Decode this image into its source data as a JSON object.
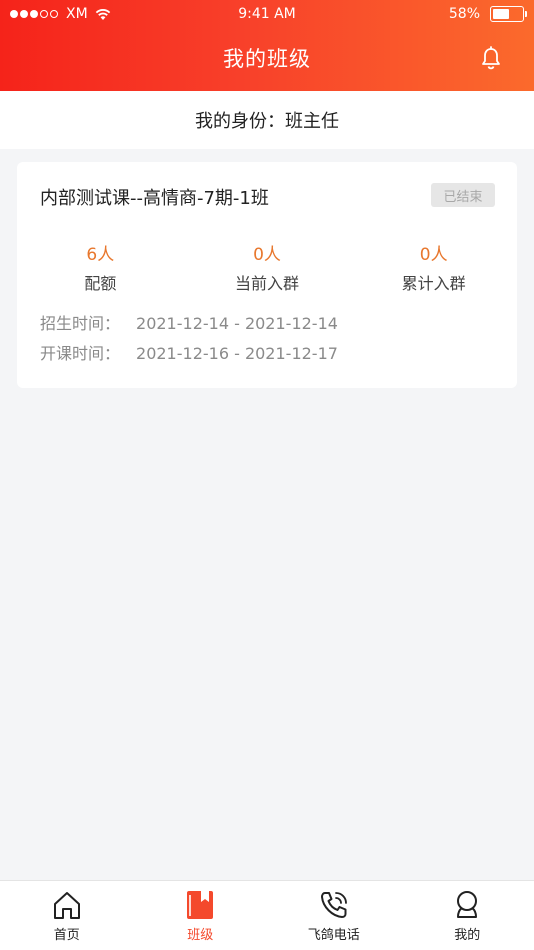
{
  "status_bar": {
    "carrier": "XM",
    "time": "9:41 AM",
    "battery": "58%",
    "battery_level": 0.58,
    "signal_filled": 3,
    "signal_total": 5
  },
  "nav": {
    "title": "我的班级",
    "bell_icon": "bell-icon"
  },
  "role": {
    "text": "我的身份：班主任"
  },
  "class_card": {
    "title": "内部测试课--高情商-7期-1班",
    "status": "已结束",
    "stats": [
      {
        "value": "6人",
        "label": "配额"
      },
      {
        "value": "0人",
        "label": "当前入群"
      },
      {
        "value": "0人",
        "label": "累计入群"
      }
    ],
    "enroll_label": "招生时间：",
    "enroll_range": "2021-12-14 - 2021-12-14",
    "class_label": "开课时间：",
    "class_range": "2021-12-16 - 2021-12-17"
  },
  "tabbar": {
    "tabs": [
      {
        "label": "首页",
        "icon": "home-icon"
      },
      {
        "label": "班级",
        "icon": "book-icon"
      },
      {
        "label": "飞鸽电话",
        "icon": "phone-icon"
      },
      {
        "label": "我的",
        "icon": "user-icon"
      }
    ],
    "active_index": 1
  },
  "colors": {
    "header_start": "#f5231a",
    "header_end": "#fb6a2c",
    "accent": "#e8772d",
    "active_tab": "#f4492c"
  }
}
